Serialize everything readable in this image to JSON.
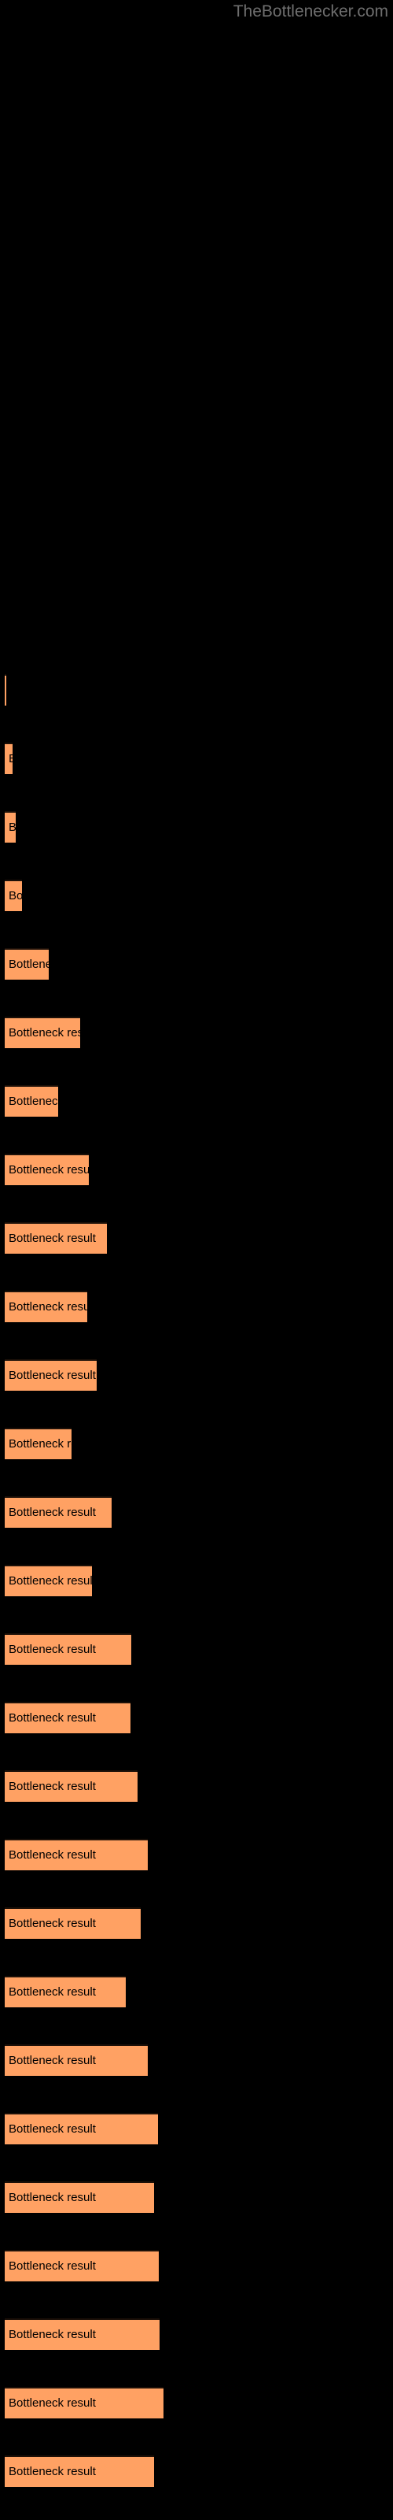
{
  "header": {
    "site_title": "TheBottlenecker.com"
  },
  "chart_data": {
    "type": "bar",
    "orientation": "horizontal",
    "title": "",
    "subtitle": "",
    "xlabel": "",
    "ylabel": "",
    "grid": false,
    "legend": null,
    "background_color": "#000000",
    "bar_fill_color": "#ffa163",
    "bar_border_color": "#1c1008",
    "label_text_color": "#000000",
    "bar_label_text": "Bottleneck result",
    "axis_visible": false,
    "tick_labels_visible": false,
    "xlim": [
      0,
      220
    ],
    "bars": [
      {
        "label": "Bottleneck result",
        "value": 2,
        "y": 856
      },
      {
        "label": "Bottleneck result",
        "value": 10,
        "y": 943
      },
      {
        "label": "Bottleneck result",
        "value": 14,
        "y": 1030
      },
      {
        "label": "Bottleneck result",
        "value": 22,
        "y": 1117
      },
      {
        "label": "Bottleneck result",
        "value": 56,
        "y": 1204
      },
      {
        "label": "Bottleneck result",
        "value": 96,
        "y": 1291
      },
      {
        "label": "Bottleneck result",
        "value": 68,
        "y": 1378
      },
      {
        "label": "Bottleneck result",
        "value": 107,
        "y": 1465
      },
      {
        "label": "Bottleneck result",
        "value": 130,
        "y": 1552
      },
      {
        "label": "Bottleneck result",
        "value": 105,
        "y": 1639
      },
      {
        "label": "Bottleneck result",
        "value": 117,
        "y": 1726
      },
      {
        "label": "Bottleneck result",
        "value": 85,
        "y": 1813
      },
      {
        "label": "Bottleneck result",
        "value": 136,
        "y": 1900
      },
      {
        "label": "Bottleneck result",
        "value": 111,
        "y": 1987
      },
      {
        "label": "Bottleneck result",
        "value": 161,
        "y": 2074
      },
      {
        "label": "Bottleneck result",
        "value": 160,
        "y": 2161
      },
      {
        "label": "Bottleneck result",
        "value": 169,
        "y": 2248
      },
      {
        "label": "Bottleneck result",
        "value": 182,
        "y": 2335
      },
      {
        "label": "Bottleneck result",
        "value": 173,
        "y": 2422
      },
      {
        "label": "Bottleneck result",
        "value": 154,
        "y": 2509
      },
      {
        "label": "Bottleneck result",
        "value": 182,
        "y": 2596
      },
      {
        "label": "Bottleneck result",
        "value": 195,
        "y": 2683
      },
      {
        "label": "Bottleneck result",
        "value": 190,
        "y": 2770
      },
      {
        "label": "Bottleneck result",
        "value": 196,
        "y": 2857
      },
      {
        "label": "Bottleneck result",
        "value": 197,
        "y": 2944
      },
      {
        "label": "Bottleneck result",
        "value": 202,
        "y": 3031
      },
      {
        "label": "Bottleneck result",
        "value": 190,
        "y": 3118
      }
    ]
  }
}
